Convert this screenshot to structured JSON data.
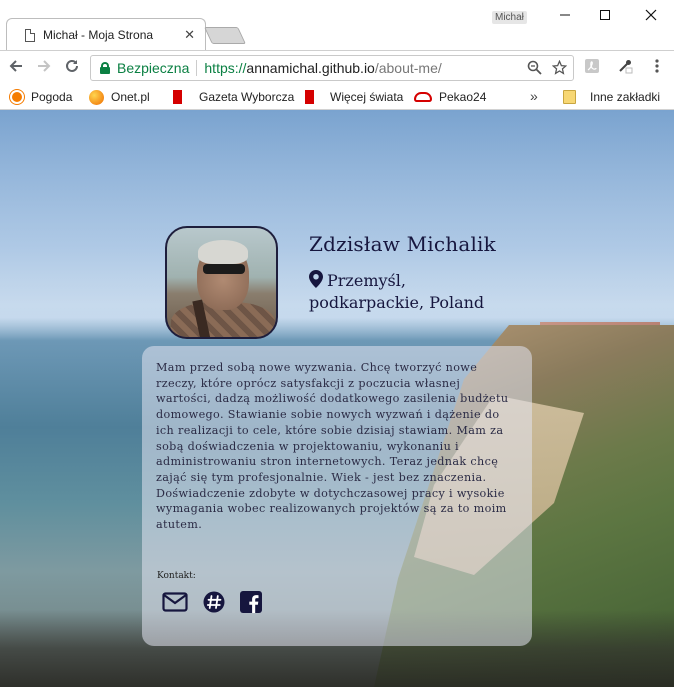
{
  "browser": {
    "tab_title": "Michał - Moja Strona",
    "tab_close": "✕",
    "profile_name": "Michał",
    "security_label": "Bezpieczna",
    "url_proto": "https://",
    "url_host": "annamichal.github.io",
    "url_path": "/about-me/",
    "bookmarks": [
      {
        "label": "Pogoda",
        "icon": "sun-icon"
      },
      {
        "label": "Onet.pl",
        "icon": "onet-icon"
      },
      {
        "label": "Gazeta Wyborcza",
        "icon": "gazeta-icon"
      },
      {
        "label": "Więcej świata",
        "icon": "wiecej-swiata-icon"
      },
      {
        "label": "Pekao24",
        "icon": "car-icon"
      }
    ],
    "more_bookmarks": "»",
    "other_bookmarks": "Inne zakładki"
  },
  "profile": {
    "name": "Zdzisław Michalik",
    "location_line1": "Przemyśl,",
    "location_line2": "podkarpackie, Poland",
    "bio": "Mam przed sobą nowe wyzwania. Chcę tworzyć nowe rzeczy, które oprócz satysfakcji z poczucia własnej wartości, dadzą możliwość dodatkowego zasilenia budżetu domowego. Stawianie sobie nowych wyzwań i dążenie do ich realizacji to cele, które sobie dzisiaj stawiam. Mam za sobą doświadczenia w projektowaniu, wykonaniu i administrowaniu stron internetowych. Teraz jednak chcę zająć się tym profesjonalnie. Wiek - jest bez znaczenia. Doświadczenie zdobyte w dotychczasowej pracy i wysokie wymagania wobec realizowanych projektów są za to moim atutem.",
    "contact_label": "Kontakt:"
  },
  "colors": {
    "text_dark": "#16163e",
    "secure_green": "#0b8043",
    "card_bg": "rgba(225,228,240,0.55)"
  }
}
